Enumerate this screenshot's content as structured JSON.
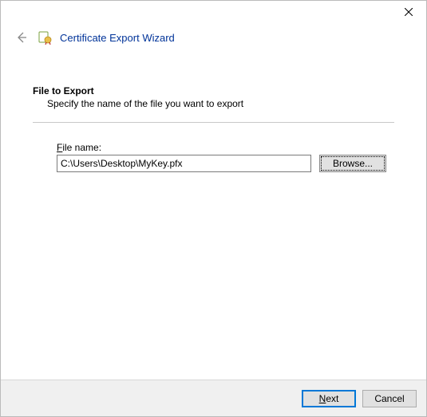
{
  "titlebar": {
    "close_name": "close"
  },
  "header": {
    "title": "Certificate Export Wizard"
  },
  "content": {
    "heading": "File to Export",
    "subheading": "Specify the name of the file you want to export"
  },
  "field": {
    "label_prefix": "F",
    "label_rest": "ile name:",
    "value": "C:\\Users\\Desktop\\MyKey.pfx",
    "browse_prefix": "B",
    "browse_mid": "r",
    "browse_rest": "owse..."
  },
  "footer": {
    "next_underline": "N",
    "next_rest": "ext",
    "cancel": "Cancel"
  }
}
